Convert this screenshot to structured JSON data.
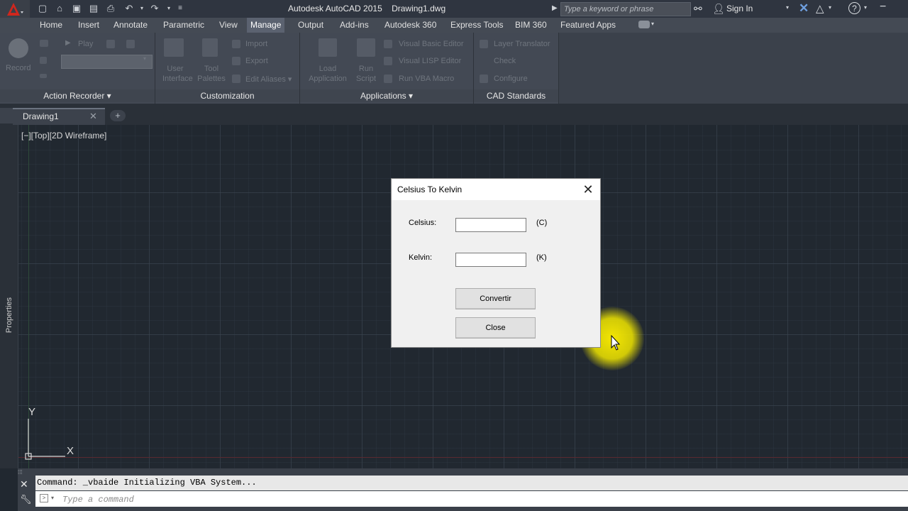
{
  "window": {
    "title": "Autodesk AutoCAD 2015    Drawing1.dwg",
    "search_placeholder": "Type a keyword or phrase",
    "sign_in": "Sign In"
  },
  "quick_access": [
    "new-icon",
    "open-icon",
    "save-icon",
    "save-as-icon",
    "print-icon",
    "undo-icon",
    "redo-icon",
    "dropdown-icon"
  ],
  "menu_tabs": [
    {
      "label": "Home",
      "active": false
    },
    {
      "label": "Insert",
      "active": false
    },
    {
      "label": "Annotate",
      "active": false
    },
    {
      "label": "Parametric",
      "active": false
    },
    {
      "label": "View",
      "active": false
    },
    {
      "label": "Manage",
      "active": true
    },
    {
      "label": "Output",
      "active": false
    },
    {
      "label": "Add-ins",
      "active": false
    },
    {
      "label": "Autodesk 360",
      "active": false
    },
    {
      "label": "Express Tools",
      "active": false
    },
    {
      "label": "BIM 360",
      "active": false
    },
    {
      "label": "Featured Apps",
      "active": false
    }
  ],
  "ribbon": {
    "action_recorder": {
      "title": "Action Recorder ▾",
      "record": "Record",
      "play": "Play"
    },
    "customization": {
      "title": "Customization",
      "user_interface": "User Interface",
      "tool_palettes": "Tool Palettes",
      "import": "Import",
      "export": "Export",
      "edit_aliases": "Edit Aliases ▾"
    },
    "applications": {
      "title": "Applications ▾",
      "load_application": "Load Application",
      "run_script": "Run Script",
      "visual_basic": "Visual Basic Editor",
      "visual_lisp": "Visual LISP Editor",
      "run_vba": "Run VBA Macro"
    },
    "cad_standards": {
      "title": "CAD Standards",
      "layer_translator": "Layer Translator",
      "check": "Check",
      "configure": "Configure"
    }
  },
  "file_tabs": [
    {
      "label": "Drawing1"
    }
  ],
  "viewport_label": "[−][Top][2D Wireframe]",
  "side_palette": "Properties",
  "dialog": {
    "title": "Celsius To Kelvin",
    "celsius_label": "Celsius:",
    "celsius_value": "",
    "celsius_unit": "(C)",
    "kelvin_label": "Kelvin:",
    "kelvin_value": "",
    "kelvin_unit": "(K)",
    "convert_button": "Convertir",
    "close_button": "Close"
  },
  "command_line": {
    "history": "Command: _vbaide Initializing VBA System...",
    "placeholder": "Type a command"
  },
  "ucs": {
    "x": "X",
    "y": "Y"
  }
}
